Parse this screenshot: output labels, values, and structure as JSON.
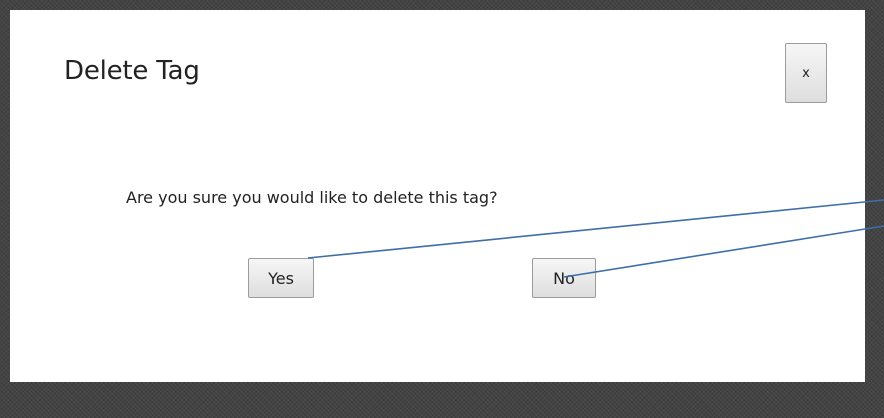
{
  "dialog": {
    "title": "Delete Tag",
    "close_label": "x",
    "message": "Are you sure you would like to delete this tag?",
    "yes_label": "Yes",
    "no_label": "No"
  },
  "colors": {
    "backdrop": "#434343",
    "dialog_background": "#ffffff",
    "annotation_line": "#3f6ea8"
  }
}
